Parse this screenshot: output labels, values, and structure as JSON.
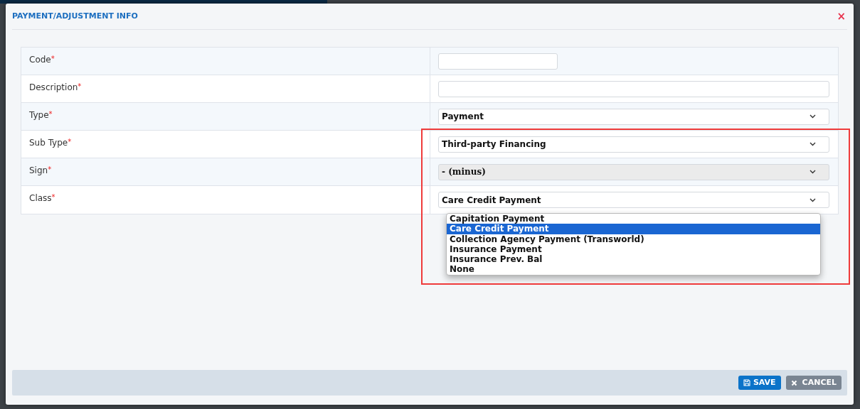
{
  "dialog": {
    "title": "PAYMENT/ADJUSTMENT INFO",
    "close": "×"
  },
  "fields": [
    {
      "label": "Code",
      "required": "*",
      "kind": "short"
    },
    {
      "label": "Description",
      "required": "*",
      "kind": "input"
    },
    {
      "label": "Type",
      "required": "*",
      "kind": "select",
      "value": "Payment",
      "disabled": false
    },
    {
      "label": "Sub Type",
      "required": "*",
      "kind": "select",
      "value": "Third-party Financing",
      "disabled": false
    },
    {
      "label": "Sign",
      "required": "*",
      "kind": "select",
      "value": "- (minus)",
      "disabled": true
    },
    {
      "label": "Class",
      "required": "*",
      "kind": "select",
      "value": "Care Credit Payment",
      "disabled": false,
      "open": true
    }
  ],
  "dropdown_options": [
    {
      "label": "Capitation Payment",
      "selected": false
    },
    {
      "label": "Care Credit Payment",
      "selected": true
    },
    {
      "label": "Collection Agency Payment (Transworld)",
      "selected": false
    },
    {
      "label": "Insurance Payment",
      "selected": false
    },
    {
      "label": "Insurance Prev. Bal",
      "selected": false
    },
    {
      "label": "None",
      "selected": false
    }
  ],
  "highlight": true,
  "buttons": [
    {
      "label": "SAVE",
      "kind": "save"
    },
    {
      "label": "CANCEL",
      "kind": "cancel"
    }
  ]
}
